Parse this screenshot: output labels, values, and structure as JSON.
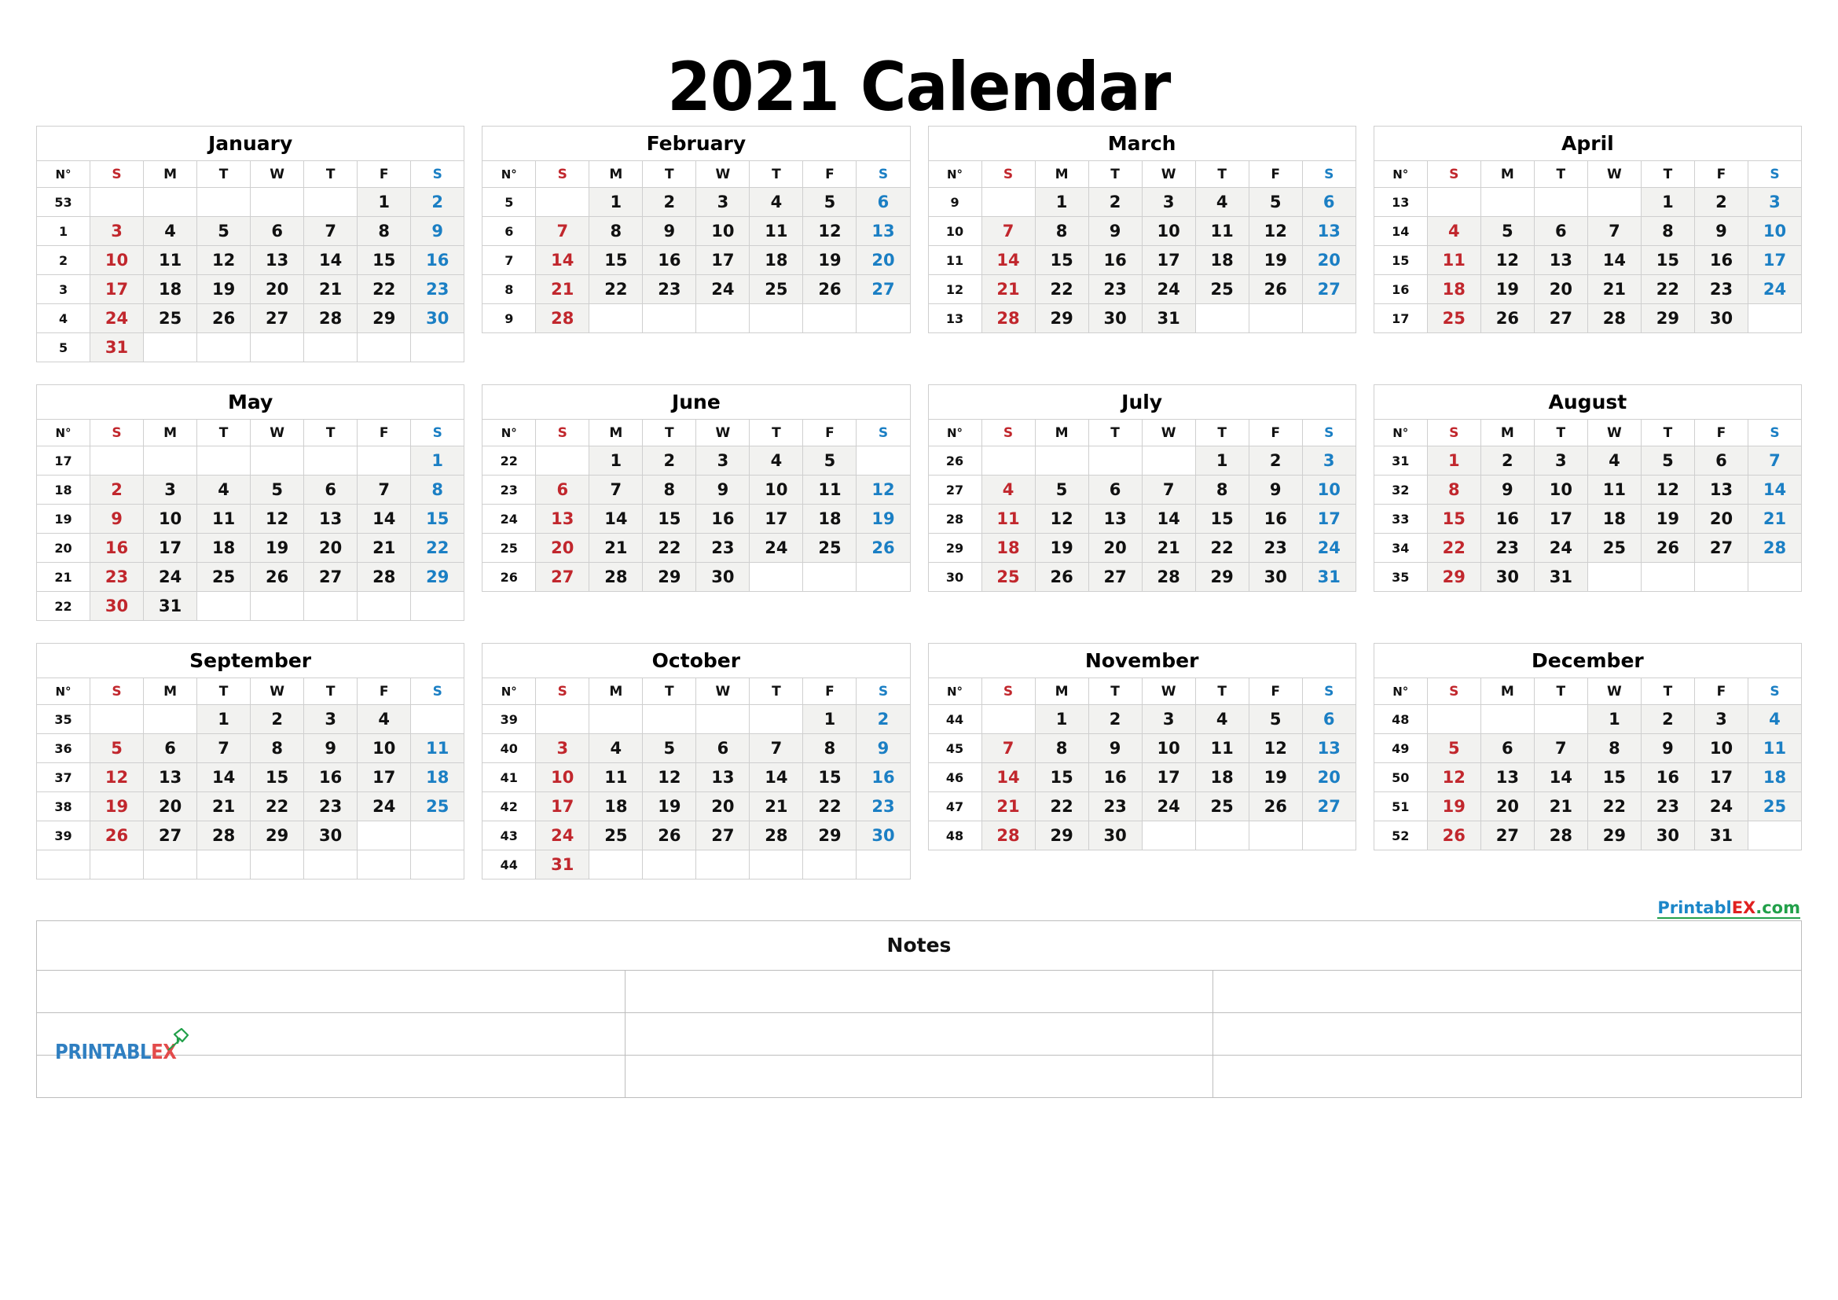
{
  "title": "2021 Calendar",
  "colors": {
    "sunday": "#c1272d",
    "saturday": "#1b7fc4",
    "day_text": "#111111",
    "cell_fill": "#f2f2f0",
    "grid_line": "#cfcfcf",
    "logo_blue": "#2f7fc1",
    "logo_red": "#e34b4b",
    "logo_green": "#22a04a",
    "link_blue": "#1b86c8",
    "link_red": "#e02020",
    "link_green": "#22a04a"
  },
  "week_col_header": "N°",
  "dow_headers": [
    "S",
    "M",
    "T",
    "W",
    "T",
    "F",
    "S"
  ],
  "months": [
    {
      "name": "January",
      "weeks": [
        {
          "wk": "53",
          "days": [
            "",
            "",
            "",
            "",
            "",
            "1",
            "2"
          ]
        },
        {
          "wk": "1",
          "days": [
            "3",
            "4",
            "5",
            "6",
            "7",
            "8",
            "9"
          ]
        },
        {
          "wk": "2",
          "days": [
            "10",
            "11",
            "12",
            "13",
            "14",
            "15",
            "16"
          ]
        },
        {
          "wk": "3",
          "days": [
            "17",
            "18",
            "19",
            "20",
            "21",
            "22",
            "23"
          ]
        },
        {
          "wk": "4",
          "days": [
            "24",
            "25",
            "26",
            "27",
            "28",
            "29",
            "30"
          ]
        },
        {
          "wk": "5",
          "days": [
            "31",
            "",
            "",
            "",
            "",
            "",
            ""
          ]
        }
      ]
    },
    {
      "name": "February",
      "weeks": [
        {
          "wk": "5",
          "days": [
            "",
            "1",
            "2",
            "3",
            "4",
            "5",
            "6"
          ]
        },
        {
          "wk": "6",
          "days": [
            "7",
            "8",
            "9",
            "10",
            "11",
            "12",
            "13"
          ]
        },
        {
          "wk": "7",
          "days": [
            "14",
            "15",
            "16",
            "17",
            "18",
            "19",
            "20"
          ]
        },
        {
          "wk": "8",
          "days": [
            "21",
            "22",
            "23",
            "24",
            "25",
            "26",
            "27"
          ]
        },
        {
          "wk": "9",
          "days": [
            "28",
            "",
            "",
            "",
            "",
            "",
            ""
          ]
        }
      ]
    },
    {
      "name": "March",
      "weeks": [
        {
          "wk": "9",
          "days": [
            "",
            "1",
            "2",
            "3",
            "4",
            "5",
            "6"
          ]
        },
        {
          "wk": "10",
          "days": [
            "7",
            "8",
            "9",
            "10",
            "11",
            "12",
            "13"
          ]
        },
        {
          "wk": "11",
          "days": [
            "14",
            "15",
            "16",
            "17",
            "18",
            "19",
            "20"
          ]
        },
        {
          "wk": "12",
          "days": [
            "21",
            "22",
            "23",
            "24",
            "25",
            "26",
            "27"
          ]
        },
        {
          "wk": "13",
          "days": [
            "28",
            "29",
            "30",
            "31",
            "",
            "",
            ""
          ]
        }
      ]
    },
    {
      "name": "April",
      "weeks": [
        {
          "wk": "13",
          "days": [
            "",
            "",
            "",
            "",
            "1",
            "2",
            "3"
          ]
        },
        {
          "wk": "14",
          "days": [
            "4",
            "5",
            "6",
            "7",
            "8",
            "9",
            "10"
          ]
        },
        {
          "wk": "15",
          "days": [
            "11",
            "12",
            "13",
            "14",
            "15",
            "16",
            "17"
          ]
        },
        {
          "wk": "16",
          "days": [
            "18",
            "19",
            "20",
            "21",
            "22",
            "23",
            "24"
          ]
        },
        {
          "wk": "17",
          "days": [
            "25",
            "26",
            "27",
            "28",
            "29",
            "30",
            ""
          ]
        }
      ]
    },
    {
      "name": "May",
      "weeks": [
        {
          "wk": "17",
          "days": [
            "",
            "",
            "",
            "",
            "",
            "",
            "1"
          ]
        },
        {
          "wk": "18",
          "days": [
            "2",
            "3",
            "4",
            "5",
            "6",
            "7",
            "8"
          ]
        },
        {
          "wk": "19",
          "days": [
            "9",
            "10",
            "11",
            "12",
            "13",
            "14",
            "15"
          ]
        },
        {
          "wk": "20",
          "days": [
            "16",
            "17",
            "18",
            "19",
            "20",
            "21",
            "22"
          ]
        },
        {
          "wk": "21",
          "days": [
            "23",
            "24",
            "25",
            "26",
            "27",
            "28",
            "29"
          ]
        },
        {
          "wk": "22",
          "days": [
            "30",
            "31",
            "",
            "",
            "",
            "",
            ""
          ]
        }
      ]
    },
    {
      "name": "June",
      "weeks": [
        {
          "wk": "22",
          "days": [
            "",
            "1",
            "2",
            "3",
            "4",
            "5",
            ""
          ]
        },
        {
          "wk": "23",
          "days": [
            "6",
            "7",
            "8",
            "9",
            "10",
            "11",
            "12"
          ]
        },
        {
          "wk": "24",
          "days": [
            "13",
            "14",
            "15",
            "16",
            "17",
            "18",
            "19"
          ]
        },
        {
          "wk": "25",
          "days": [
            "20",
            "21",
            "22",
            "23",
            "24",
            "25",
            "26"
          ]
        },
        {
          "wk": "26",
          "days": [
            "27",
            "28",
            "29",
            "30",
            "",
            "",
            ""
          ]
        }
      ]
    },
    {
      "name": "July",
      "weeks": [
        {
          "wk": "26",
          "days": [
            "",
            "",
            "",
            "",
            "1",
            "2",
            "3"
          ]
        },
        {
          "wk": "27",
          "days": [
            "4",
            "5",
            "6",
            "7",
            "8",
            "9",
            "10"
          ]
        },
        {
          "wk": "28",
          "days": [
            "11",
            "12",
            "13",
            "14",
            "15",
            "16",
            "17"
          ]
        },
        {
          "wk": "29",
          "days": [
            "18",
            "19",
            "20",
            "21",
            "22",
            "23",
            "24"
          ]
        },
        {
          "wk": "30",
          "days": [
            "25",
            "26",
            "27",
            "28",
            "29",
            "30",
            "31"
          ]
        }
      ]
    },
    {
      "name": "August",
      "weeks": [
        {
          "wk": "31",
          "days": [
            "1",
            "2",
            "3",
            "4",
            "5",
            "6",
            "7"
          ]
        },
        {
          "wk": "32",
          "days": [
            "8",
            "9",
            "10",
            "11",
            "12",
            "13",
            "14"
          ]
        },
        {
          "wk": "33",
          "days": [
            "15",
            "16",
            "17",
            "18",
            "19",
            "20",
            "21"
          ]
        },
        {
          "wk": "34",
          "days": [
            "22",
            "23",
            "24",
            "25",
            "26",
            "27",
            "28"
          ]
        },
        {
          "wk": "35",
          "days": [
            "29",
            "30",
            "31",
            "",
            "",
            "",
            ""
          ]
        }
      ]
    },
    {
      "name": "September",
      "weeks": [
        {
          "wk": "35",
          "days": [
            "",
            "",
            "1",
            "2",
            "3",
            "4",
            ""
          ]
        },
        {
          "wk": "36",
          "days": [
            "5",
            "6",
            "7",
            "8",
            "9",
            "10",
            "11"
          ]
        },
        {
          "wk": "37",
          "days": [
            "12",
            "13",
            "14",
            "15",
            "16",
            "17",
            "18"
          ]
        },
        {
          "wk": "38",
          "days": [
            "19",
            "20",
            "21",
            "22",
            "23",
            "24",
            "25"
          ]
        },
        {
          "wk": "39",
          "days": [
            "26",
            "27",
            "28",
            "29",
            "30",
            "",
            ""
          ]
        },
        {
          "wk": "",
          "days": [
            "",
            "",
            "",
            "",
            "",
            "",
            ""
          ]
        }
      ]
    },
    {
      "name": "October",
      "weeks": [
        {
          "wk": "39",
          "days": [
            "",
            "",
            "",
            "",
            "",
            "1",
            "2"
          ]
        },
        {
          "wk": "40",
          "days": [
            "3",
            "4",
            "5",
            "6",
            "7",
            "8",
            "9"
          ]
        },
        {
          "wk": "41",
          "days": [
            "10",
            "11",
            "12",
            "13",
            "14",
            "15",
            "16"
          ]
        },
        {
          "wk": "42",
          "days": [
            "17",
            "18",
            "19",
            "20",
            "21",
            "22",
            "23"
          ]
        },
        {
          "wk": "43",
          "days": [
            "24",
            "25",
            "26",
            "27",
            "28",
            "29",
            "30"
          ]
        },
        {
          "wk": "44",
          "days": [
            "31",
            "",
            "",
            "",
            "",
            "",
            ""
          ]
        }
      ]
    },
    {
      "name": "November",
      "weeks": [
        {
          "wk": "44",
          "days": [
            "",
            "1",
            "2",
            "3",
            "4",
            "5",
            "6"
          ]
        },
        {
          "wk": "45",
          "days": [
            "7",
            "8",
            "9",
            "10",
            "11",
            "12",
            "13"
          ]
        },
        {
          "wk": "46",
          "days": [
            "14",
            "15",
            "16",
            "17",
            "18",
            "19",
            "20"
          ]
        },
        {
          "wk": "47",
          "days": [
            "21",
            "22",
            "23",
            "24",
            "25",
            "26",
            "27"
          ]
        },
        {
          "wk": "48",
          "days": [
            "28",
            "29",
            "30",
            "",
            "",
            "",
            ""
          ]
        }
      ]
    },
    {
      "name": "December",
      "weeks": [
        {
          "wk": "48",
          "days": [
            "",
            "",
            "",
            "1",
            "2",
            "3",
            "4"
          ]
        },
        {
          "wk": "49",
          "days": [
            "5",
            "6",
            "7",
            "8",
            "9",
            "10",
            "11"
          ]
        },
        {
          "wk": "50",
          "days": [
            "12",
            "13",
            "14",
            "15",
            "16",
            "17",
            "18"
          ]
        },
        {
          "wk": "51",
          "days": [
            "19",
            "20",
            "21",
            "22",
            "23",
            "24",
            "25"
          ]
        },
        {
          "wk": "52",
          "days": [
            "26",
            "27",
            "28",
            "29",
            "30",
            "31",
            ""
          ]
        }
      ]
    }
  ],
  "footer": {
    "site_link": {
      "part1": "Printabl",
      "part2": "EX",
      "part3": ".com"
    },
    "logo": {
      "part1": "PRINTABL",
      "part2": "EX"
    },
    "notes_title": "Notes",
    "notes_rows": 3,
    "notes_cols": 3
  }
}
